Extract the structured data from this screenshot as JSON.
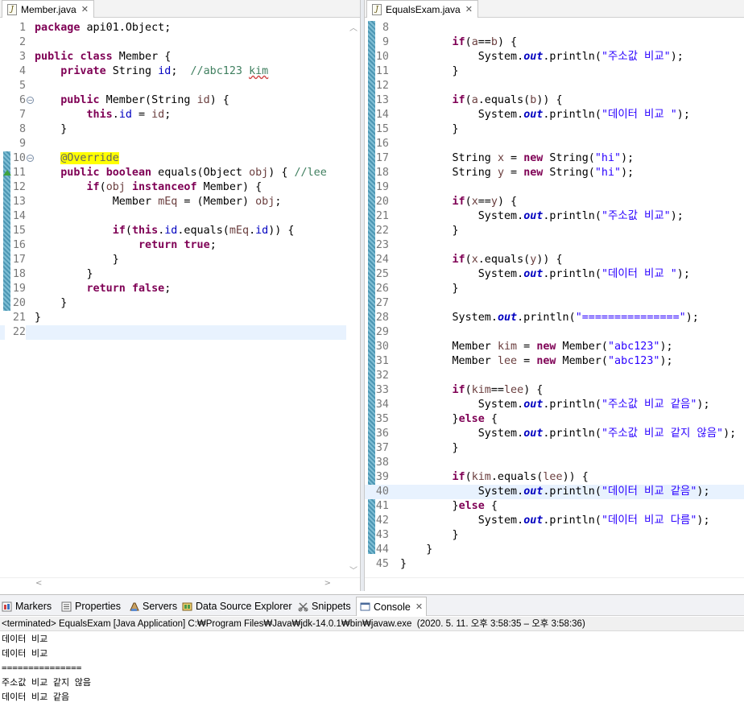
{
  "left_editor": {
    "tab_label": "Member.java",
    "close_glyph": "✕",
    "lines": [
      {
        "n": "1",
        "code": "<span class=\"kw\">package</span> api01.Object;"
      },
      {
        "n": "2",
        "code": ""
      },
      {
        "n": "3",
        "code": "<span class=\"kw\">public</span> <span class=\"kw\">class</span> Member {"
      },
      {
        "n": "4",
        "code": "    <span class=\"kw\">private</span> String <span class=\"fld\">id</span>;  <span class=\"cm\">//abc123 <span class=\"spell\">kim</span></span>"
      },
      {
        "n": "5",
        "code": ""
      },
      {
        "n": "6",
        "code": "    <span class=\"kw\">public</span> Member(String <span class=\"prm\">id</span>) {",
        "fold": "-"
      },
      {
        "n": "7",
        "code": "        <span class=\"kw\">this</span>.<span class=\"fld\">id</span> = <span class=\"prm\">id</span>;"
      },
      {
        "n": "8",
        "code": "    }"
      },
      {
        "n": "9",
        "code": ""
      },
      {
        "n": "10",
        "code": "    <span class=\"ann\">@Override</span>",
        "fold": "-"
      },
      {
        "n": "11",
        "code": "    <span class=\"kw\">public</span> <span class=\"kw\">boolean</span> equals(Object <span class=\"prm\">obj</span>) { <span class=\"cm\">//lee</span>",
        "override": true
      },
      {
        "n": "12",
        "code": "        <span class=\"kw\">if</span>(<span class=\"prm\">obj</span> <span class=\"kw\">instanceof</span> Member) {"
      },
      {
        "n": "13",
        "code": "            Member <span class=\"prm\">mEq</span> = (Member) <span class=\"prm\">obj</span>;"
      },
      {
        "n": "14",
        "code": ""
      },
      {
        "n": "15",
        "code": "            <span class=\"kw\">if</span>(<span class=\"kw\">this</span>.<span class=\"fld\">id</span>.equals(<span class=\"prm\">mEq</span>.<span class=\"fld\">id</span>)) {"
      },
      {
        "n": "16",
        "code": "                <span class=\"kw\">return</span> <span class=\"kw\">true</span>;"
      },
      {
        "n": "17",
        "code": "            }"
      },
      {
        "n": "18",
        "code": "        }"
      },
      {
        "n": "19",
        "code": "        <span class=\"kw\">return</span> <span class=\"kw\">false</span>;"
      },
      {
        "n": "20",
        "code": "    }"
      },
      {
        "n": "21",
        "code": "}"
      },
      {
        "n": "22",
        "code": "",
        "current": true
      }
    ]
  },
  "right_editor": {
    "tab_label": "EqualsExam.java",
    "close_glyph": "✕",
    "lines": [
      {
        "n": "8",
        "code": ""
      },
      {
        "n": "9",
        "code": "        <span class=\"kw\">if</span>(<span class=\"prm\">a</span>==<span class=\"prm\">b</span>) {"
      },
      {
        "n": "10",
        "code": "            System.<span class=\"sfld\">out</span>.println(<span class=\"str\">\"주소값 비교\"</span>);"
      },
      {
        "n": "11",
        "code": "        }"
      },
      {
        "n": "12",
        "code": ""
      },
      {
        "n": "13",
        "code": "        <span class=\"kw\">if</span>(<span class=\"prm\">a</span>.equals(<span class=\"prm\">b</span>)) {"
      },
      {
        "n": "14",
        "code": "            System.<span class=\"sfld\">out</span>.println(<span class=\"str\">\"데이터 비교 \"</span>);"
      },
      {
        "n": "15",
        "code": "        }"
      },
      {
        "n": "16",
        "code": ""
      },
      {
        "n": "17",
        "code": "        String <span class=\"prm\">x</span> = <span class=\"kw\">new</span> String(<span class=\"str\">\"hi\"</span>);"
      },
      {
        "n": "18",
        "code": "        String <span class=\"prm\">y</span> = <span class=\"kw\">new</span> String(<span class=\"str\">\"hi\"</span>);"
      },
      {
        "n": "19",
        "code": ""
      },
      {
        "n": "20",
        "code": "        <span class=\"kw\">if</span>(<span class=\"prm\">x</span>==<span class=\"prm\">y</span>) {"
      },
      {
        "n": "21",
        "code": "            System.<span class=\"sfld\">out</span>.println(<span class=\"str\">\"주소값 비교\"</span>);"
      },
      {
        "n": "22",
        "code": "        }"
      },
      {
        "n": "23",
        "code": ""
      },
      {
        "n": "24",
        "code": "        <span class=\"kw\">if</span>(<span class=\"prm\">x</span>.equals(<span class=\"prm\">y</span>)) {"
      },
      {
        "n": "25",
        "code": "            System.<span class=\"sfld\">out</span>.println(<span class=\"str\">\"데이터 비교 \"</span>);"
      },
      {
        "n": "26",
        "code": "        }"
      },
      {
        "n": "27",
        "code": ""
      },
      {
        "n": "28",
        "code": "        System.<span class=\"sfld\">out</span>.println(<span class=\"str\">\"===============\"</span>);"
      },
      {
        "n": "29",
        "code": ""
      },
      {
        "n": "30",
        "code": "        Member <span class=\"prm\">kim</span> = <span class=\"kw\">new</span> Member(<span class=\"str\">\"abc123\"</span>);"
      },
      {
        "n": "31",
        "code": "        Member <span class=\"prm\">lee</span> = <span class=\"kw\">new</span> Member(<span class=\"str\">\"abc123\"</span>);"
      },
      {
        "n": "32",
        "code": ""
      },
      {
        "n": "33",
        "code": "        <span class=\"kw\">if</span>(<span class=\"prm\">kim</span>==<span class=\"prm\">lee</span>) {"
      },
      {
        "n": "34",
        "code": "            System.<span class=\"sfld\">out</span>.println(<span class=\"str\">\"주소값 비교 같음\"</span>);"
      },
      {
        "n": "35",
        "code": "        }<span class=\"kw\">else</span> {"
      },
      {
        "n": "36",
        "code": "            System.<span class=\"sfld\">out</span>.println(<span class=\"str\">\"주소값 비교 같지 않음\"</span>);"
      },
      {
        "n": "37",
        "code": "        }"
      },
      {
        "n": "38",
        "code": ""
      },
      {
        "n": "39",
        "code": "        <span class=\"kw\">if</span>(<span class=\"prm\">kim</span>.equals(<span class=\"prm\">lee</span>)) {"
      },
      {
        "n": "40",
        "code": "            System.<span class=\"sfld\">out</span>.println(<span class=\"str\">\"데이터 비교 같음\"</span>);",
        "current": true
      },
      {
        "n": "41",
        "code": "        }<span class=\"kw\">else</span> {"
      },
      {
        "n": "42",
        "code": "            System.<span class=\"sfld\">out</span>.println(<span class=\"str\">\"데이터 비교 다름\"</span>);"
      },
      {
        "n": "43",
        "code": "        }"
      },
      {
        "n": "44",
        "code": "    }"
      },
      {
        "n": "45",
        "code": "}"
      }
    ]
  },
  "bottom_panel": {
    "tabs": [
      {
        "label": "Markers",
        "icon": "markers-icon",
        "active": false
      },
      {
        "label": "Properties",
        "icon": "properties-icon",
        "active": false
      },
      {
        "label": "Servers",
        "icon": "servers-icon",
        "active": false
      },
      {
        "label": "Data Source Explorer",
        "icon": "data-source-explorer-icon",
        "active": false
      },
      {
        "label": "Snippets",
        "icon": "snippets-icon",
        "active": false
      },
      {
        "label": "Console",
        "icon": "console-icon",
        "active": true
      }
    ],
    "console_close_glyph": "✕",
    "status": "<terminated> EqualsExam [Java Application] C:₩Program Files₩Java₩jdk-14.0.1₩bin₩javaw.exe  (2020. 5. 11. 오후 3:58:35 – 오후 3:58:36)",
    "output": [
      "데이터 비교",
      "데이터 비교",
      "===============",
      "주소값 비교 같지 않음",
      "데이터 비교 같음"
    ]
  },
  "colors": {
    "keyword": "#7f0055",
    "string": "#2a00ff",
    "comment": "#3f7f5f",
    "field": "#0000c0",
    "annotation_highlight": "#ffff00",
    "current_line": "#e8f2fe"
  }
}
